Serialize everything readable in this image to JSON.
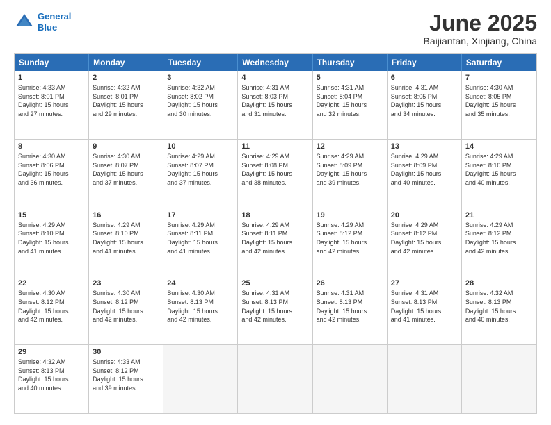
{
  "logo": {
    "line1": "General",
    "line2": "Blue"
  },
  "title": "June 2025",
  "location": "Baijiantan, Xinjiang, China",
  "headers": [
    "Sunday",
    "Monday",
    "Tuesday",
    "Wednesday",
    "Thursday",
    "Friday",
    "Saturday"
  ],
  "weeks": [
    [
      {
        "day": "1",
        "lines": [
          "Sunrise: 4:33 AM",
          "Sunset: 8:01 PM",
          "Daylight: 15 hours",
          "and 27 minutes."
        ]
      },
      {
        "day": "2",
        "lines": [
          "Sunrise: 4:32 AM",
          "Sunset: 8:01 PM",
          "Daylight: 15 hours",
          "and 29 minutes."
        ]
      },
      {
        "day": "3",
        "lines": [
          "Sunrise: 4:32 AM",
          "Sunset: 8:02 PM",
          "Daylight: 15 hours",
          "and 30 minutes."
        ]
      },
      {
        "day": "4",
        "lines": [
          "Sunrise: 4:31 AM",
          "Sunset: 8:03 PM",
          "Daylight: 15 hours",
          "and 31 minutes."
        ]
      },
      {
        "day": "5",
        "lines": [
          "Sunrise: 4:31 AM",
          "Sunset: 8:04 PM",
          "Daylight: 15 hours",
          "and 32 minutes."
        ]
      },
      {
        "day": "6",
        "lines": [
          "Sunrise: 4:31 AM",
          "Sunset: 8:05 PM",
          "Daylight: 15 hours",
          "and 34 minutes."
        ]
      },
      {
        "day": "7",
        "lines": [
          "Sunrise: 4:30 AM",
          "Sunset: 8:05 PM",
          "Daylight: 15 hours",
          "and 35 minutes."
        ]
      }
    ],
    [
      {
        "day": "8",
        "lines": [
          "Sunrise: 4:30 AM",
          "Sunset: 8:06 PM",
          "Daylight: 15 hours",
          "and 36 minutes."
        ]
      },
      {
        "day": "9",
        "lines": [
          "Sunrise: 4:30 AM",
          "Sunset: 8:07 PM",
          "Daylight: 15 hours",
          "and 37 minutes."
        ]
      },
      {
        "day": "10",
        "lines": [
          "Sunrise: 4:29 AM",
          "Sunset: 8:07 PM",
          "Daylight: 15 hours",
          "and 37 minutes."
        ]
      },
      {
        "day": "11",
        "lines": [
          "Sunrise: 4:29 AM",
          "Sunset: 8:08 PM",
          "Daylight: 15 hours",
          "and 38 minutes."
        ]
      },
      {
        "day": "12",
        "lines": [
          "Sunrise: 4:29 AM",
          "Sunset: 8:09 PM",
          "Daylight: 15 hours",
          "and 39 minutes."
        ]
      },
      {
        "day": "13",
        "lines": [
          "Sunrise: 4:29 AM",
          "Sunset: 8:09 PM",
          "Daylight: 15 hours",
          "and 40 minutes."
        ]
      },
      {
        "day": "14",
        "lines": [
          "Sunrise: 4:29 AM",
          "Sunset: 8:10 PM",
          "Daylight: 15 hours",
          "and 40 minutes."
        ]
      }
    ],
    [
      {
        "day": "15",
        "lines": [
          "Sunrise: 4:29 AM",
          "Sunset: 8:10 PM",
          "Daylight: 15 hours",
          "and 41 minutes."
        ]
      },
      {
        "day": "16",
        "lines": [
          "Sunrise: 4:29 AM",
          "Sunset: 8:10 PM",
          "Daylight: 15 hours",
          "and 41 minutes."
        ]
      },
      {
        "day": "17",
        "lines": [
          "Sunrise: 4:29 AM",
          "Sunset: 8:11 PM",
          "Daylight: 15 hours",
          "and 41 minutes."
        ]
      },
      {
        "day": "18",
        "lines": [
          "Sunrise: 4:29 AM",
          "Sunset: 8:11 PM",
          "Daylight: 15 hours",
          "and 42 minutes."
        ]
      },
      {
        "day": "19",
        "lines": [
          "Sunrise: 4:29 AM",
          "Sunset: 8:12 PM",
          "Daylight: 15 hours",
          "and 42 minutes."
        ]
      },
      {
        "day": "20",
        "lines": [
          "Sunrise: 4:29 AM",
          "Sunset: 8:12 PM",
          "Daylight: 15 hours",
          "and 42 minutes."
        ]
      },
      {
        "day": "21",
        "lines": [
          "Sunrise: 4:29 AM",
          "Sunset: 8:12 PM",
          "Daylight: 15 hours",
          "and 42 minutes."
        ]
      }
    ],
    [
      {
        "day": "22",
        "lines": [
          "Sunrise: 4:30 AM",
          "Sunset: 8:12 PM",
          "Daylight: 15 hours",
          "and 42 minutes."
        ]
      },
      {
        "day": "23",
        "lines": [
          "Sunrise: 4:30 AM",
          "Sunset: 8:12 PM",
          "Daylight: 15 hours",
          "and 42 minutes."
        ]
      },
      {
        "day": "24",
        "lines": [
          "Sunrise: 4:30 AM",
          "Sunset: 8:13 PM",
          "Daylight: 15 hours",
          "and 42 minutes."
        ]
      },
      {
        "day": "25",
        "lines": [
          "Sunrise: 4:31 AM",
          "Sunset: 8:13 PM",
          "Daylight: 15 hours",
          "and 42 minutes."
        ]
      },
      {
        "day": "26",
        "lines": [
          "Sunrise: 4:31 AM",
          "Sunset: 8:13 PM",
          "Daylight: 15 hours",
          "and 42 minutes."
        ]
      },
      {
        "day": "27",
        "lines": [
          "Sunrise: 4:31 AM",
          "Sunset: 8:13 PM",
          "Daylight: 15 hours",
          "and 41 minutes."
        ]
      },
      {
        "day": "28",
        "lines": [
          "Sunrise: 4:32 AM",
          "Sunset: 8:13 PM",
          "Daylight: 15 hours",
          "and 40 minutes."
        ]
      }
    ],
    [
      {
        "day": "29",
        "lines": [
          "Sunrise: 4:32 AM",
          "Sunset: 8:13 PM",
          "Daylight: 15 hours",
          "and 40 minutes."
        ]
      },
      {
        "day": "30",
        "lines": [
          "Sunrise: 4:33 AM",
          "Sunset: 8:12 PM",
          "Daylight: 15 hours",
          "and 39 minutes."
        ]
      },
      {
        "day": "",
        "lines": []
      },
      {
        "day": "",
        "lines": []
      },
      {
        "day": "",
        "lines": []
      },
      {
        "day": "",
        "lines": []
      },
      {
        "day": "",
        "lines": []
      }
    ]
  ]
}
